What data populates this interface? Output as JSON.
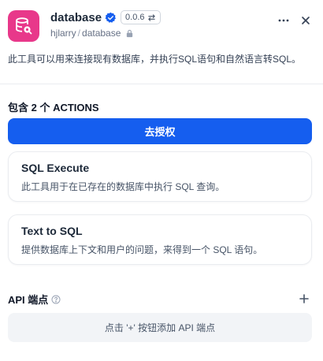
{
  "header": {
    "tool_name": "database",
    "version": "0.0.6",
    "author": "hjlarry",
    "separator": "/",
    "slug": "database",
    "icons": {
      "tool": "database-search-icon",
      "verified": "verified-badge-icon",
      "version_switch": "swap-icon",
      "lock": "lock-icon",
      "more": "more-horizontal-icon",
      "close": "close-icon"
    },
    "brand_color": "#e8388a"
  },
  "description": "此工具可以用来连接现有数据库，并执行SQL语句和自然语言转SQL。",
  "actions": {
    "heading": "包含 2 个 ACTIONS",
    "authorize_label": "去授权",
    "accent_color": "#155eef",
    "items": [
      {
        "name": "SQL Execute",
        "description": "此工具用于在已存在的数据库中执行 SQL 查询。"
      },
      {
        "name": "Text to SQL",
        "description": "提供数据库上下文和用户的问题，来得到一个 SQL 语句。"
      }
    ]
  },
  "api": {
    "heading": "API 端点",
    "info_icon": "info-circle-icon",
    "add_icon": "plus-icon",
    "add_endpoint_label": "点击 '+' 按钮添加 API 端点"
  }
}
